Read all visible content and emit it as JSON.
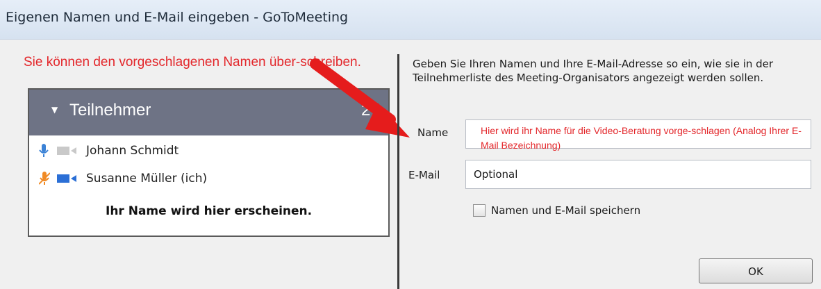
{
  "window": {
    "title": "Eigenen Namen und E-Mail eingeben - GoToMeeting"
  },
  "annotations": {
    "top_note": "Sie können den vorgeschlagenen Namen über-schreiben.",
    "name_note": "Hier wird ihr Name für die Video-Beratung vorge-schlagen (Analog Ihrer E-Mail Bezeichnung)",
    "note_color": "#e3262a"
  },
  "participants_panel": {
    "title": "Teilnehmer",
    "count": "2",
    "header_color": "#6e7385",
    "participants": [
      {
        "name": "Johann Schmidt",
        "mic_icon": "microphone-icon",
        "mic_color": "#3b82d6",
        "cam_icon": "camera-icon",
        "cam_color": "#c9c9c9"
      },
      {
        "name": "Susanne Müller (ich)",
        "mic_icon": "microphone-muted-icon",
        "mic_color": "#f08a24",
        "cam_icon": "camera-icon",
        "cam_color": "#2b6fd6"
      }
    ],
    "placeholder_note": "Ihr Name wird hier erscheinen."
  },
  "form": {
    "instructions": "Geben Sie Ihren Namen und Ihre E-Mail-Adresse so ein, wie sie in der Teilnehmerliste des Meeting-Organisators angezeigt werden sollen.",
    "name_label": "Name",
    "name_value": "",
    "email_label": "E-Mail",
    "email_value": "Optional",
    "save_checkbox_label": "Namen und E-Mail speichern",
    "save_checked": false,
    "ok_label": "OK"
  }
}
